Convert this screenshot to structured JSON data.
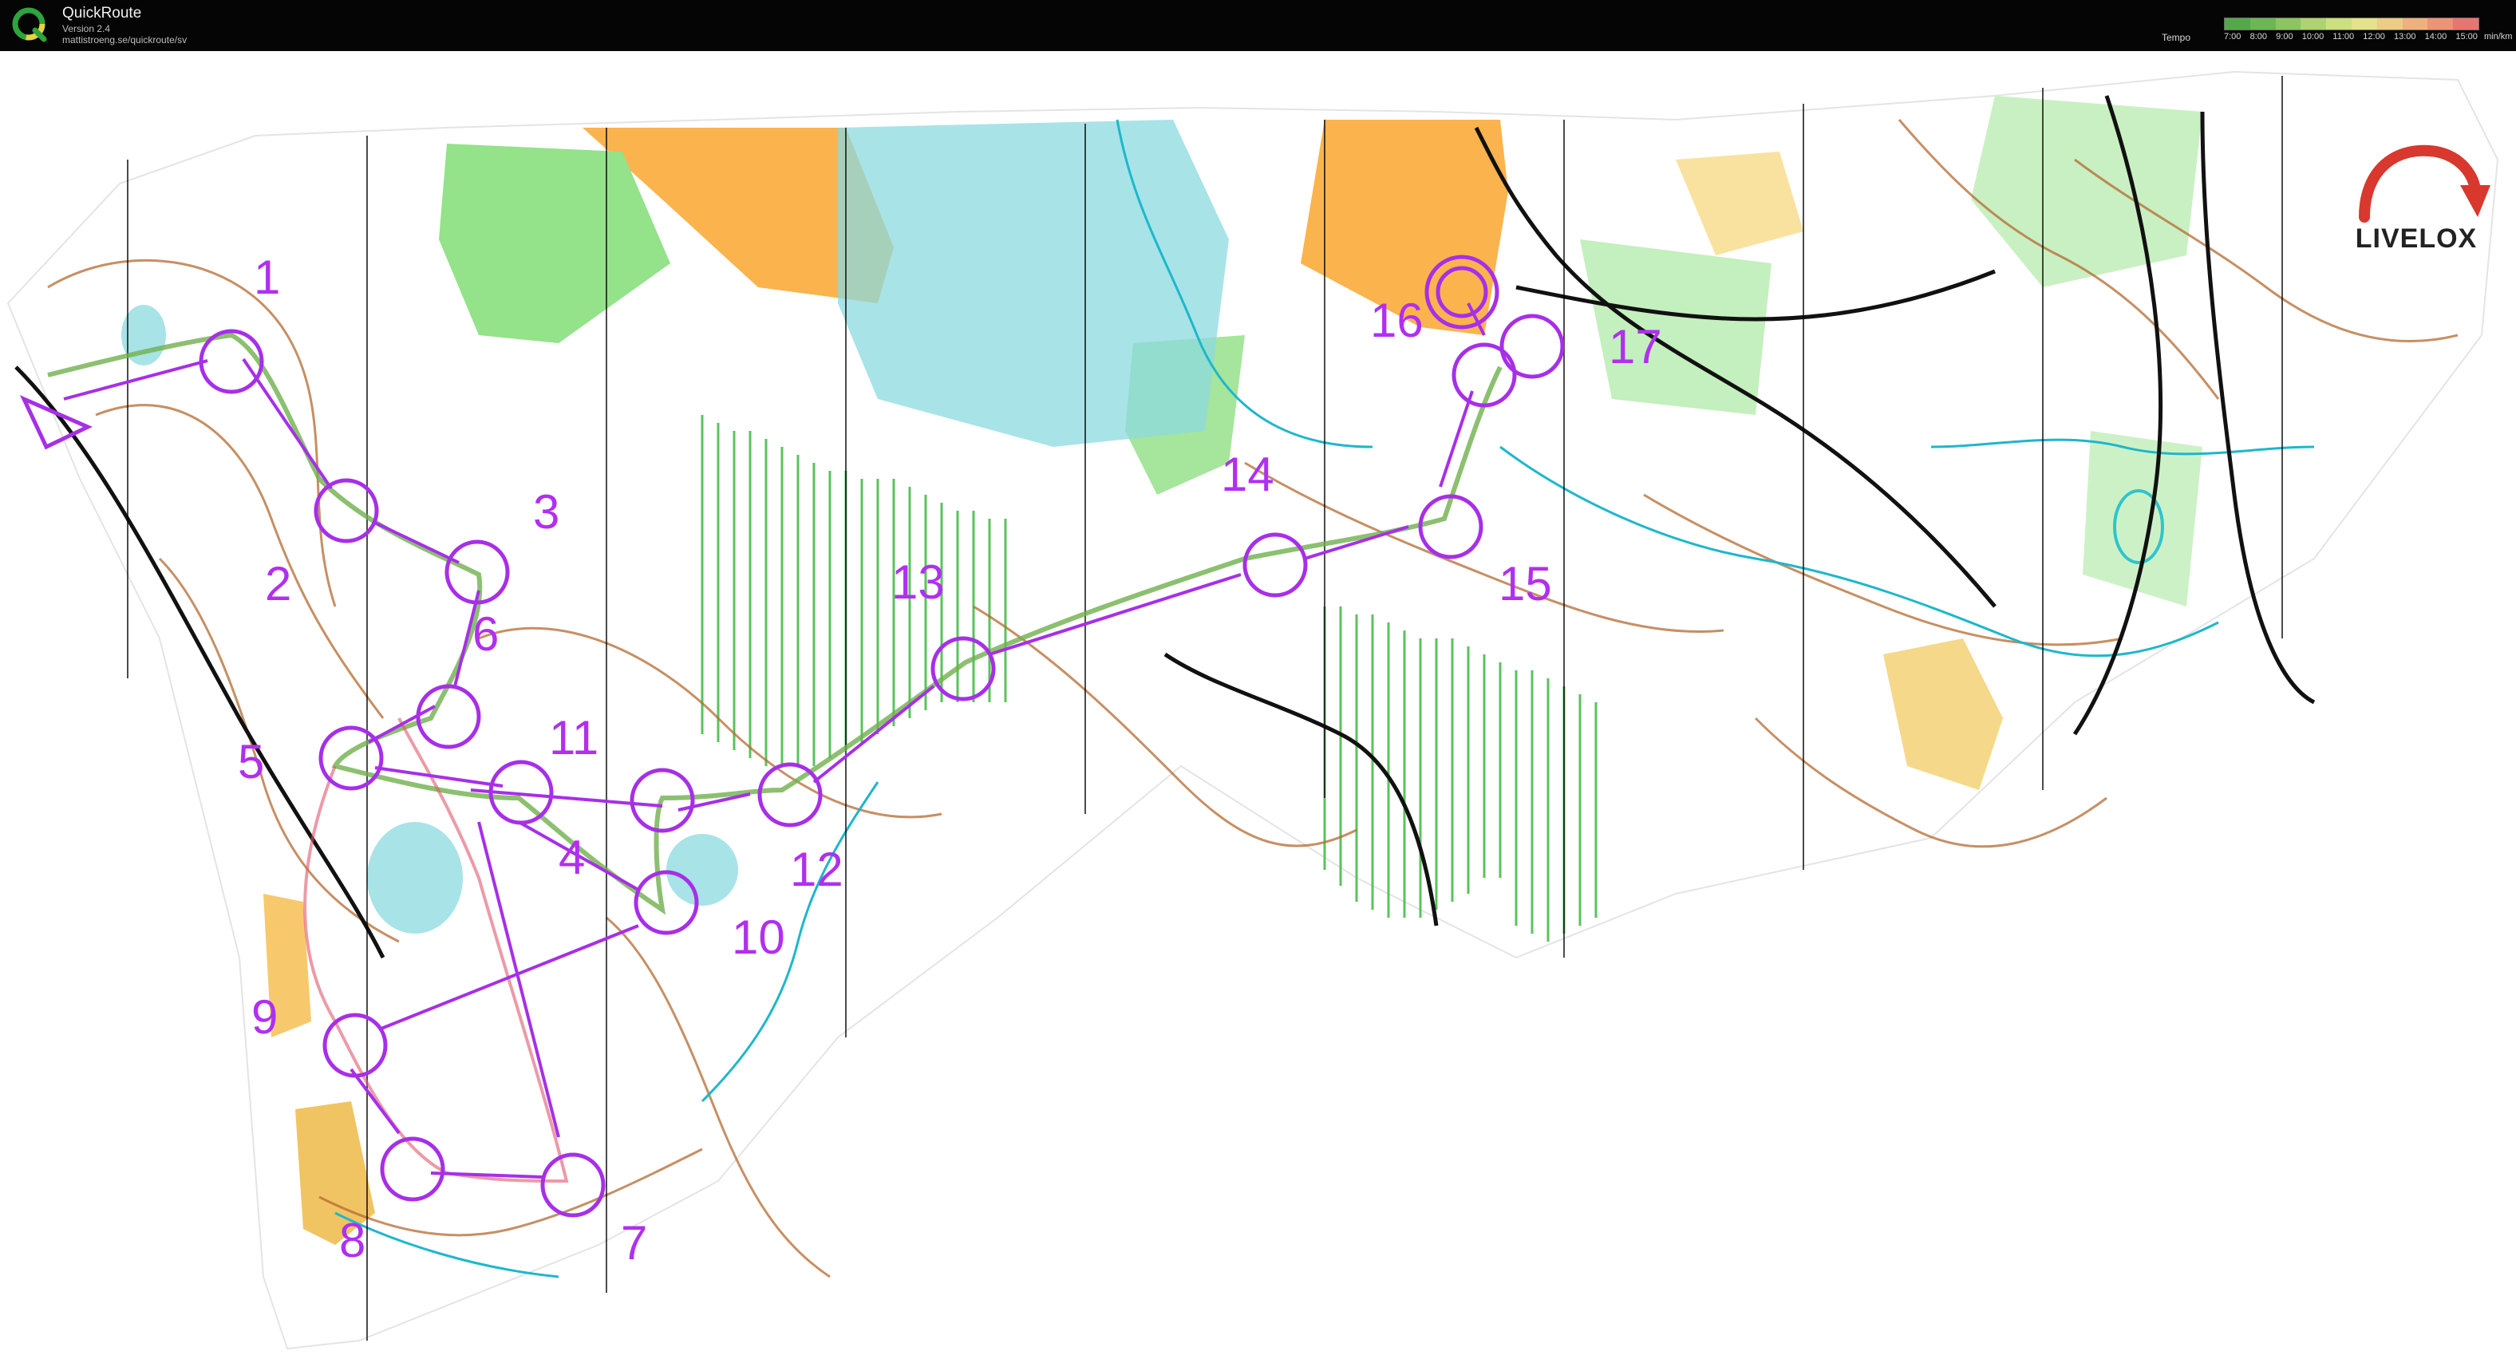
{
  "window": {
    "app_title": "QuickRoute",
    "version": "Version 2.4",
    "url": "mattistroeng.se/quickroute/sv"
  },
  "tempo": {
    "label": "Tempo",
    "ticks": [
      "7:00",
      "8:00",
      "9:00",
      "10:00",
      "11:00",
      "12:00",
      "13:00",
      "14:00",
      "15:00"
    ],
    "unit": "min/km",
    "scale_colors": [
      "#53a84a",
      "#6cb653",
      "#8cc55f",
      "#acd36d",
      "#cce07c",
      "#e5e38a",
      "#eccd83",
      "#eeb17b",
      "#ee9375",
      "#ea7470"
    ]
  },
  "course": {
    "color": "#a72fe8",
    "start_icon": "start-triangle",
    "finish_icon": "finish-double-circle",
    "controls": [
      "1",
      "2",
      "3",
      "4",
      "5",
      "6",
      "7",
      "8",
      "9",
      "10",
      "11",
      "12",
      "13",
      "14",
      "15",
      "16",
      "17"
    ]
  },
  "watermark": {
    "brand": "LIVELOX",
    "icon": "curved-arrow-icon"
  },
  "colors": {
    "open_land": "#fbb34d",
    "forest_green": "#94e28a",
    "marsh": "#2ec4cf",
    "contour": "#a55a21",
    "route": "#6fb04c"
  }
}
